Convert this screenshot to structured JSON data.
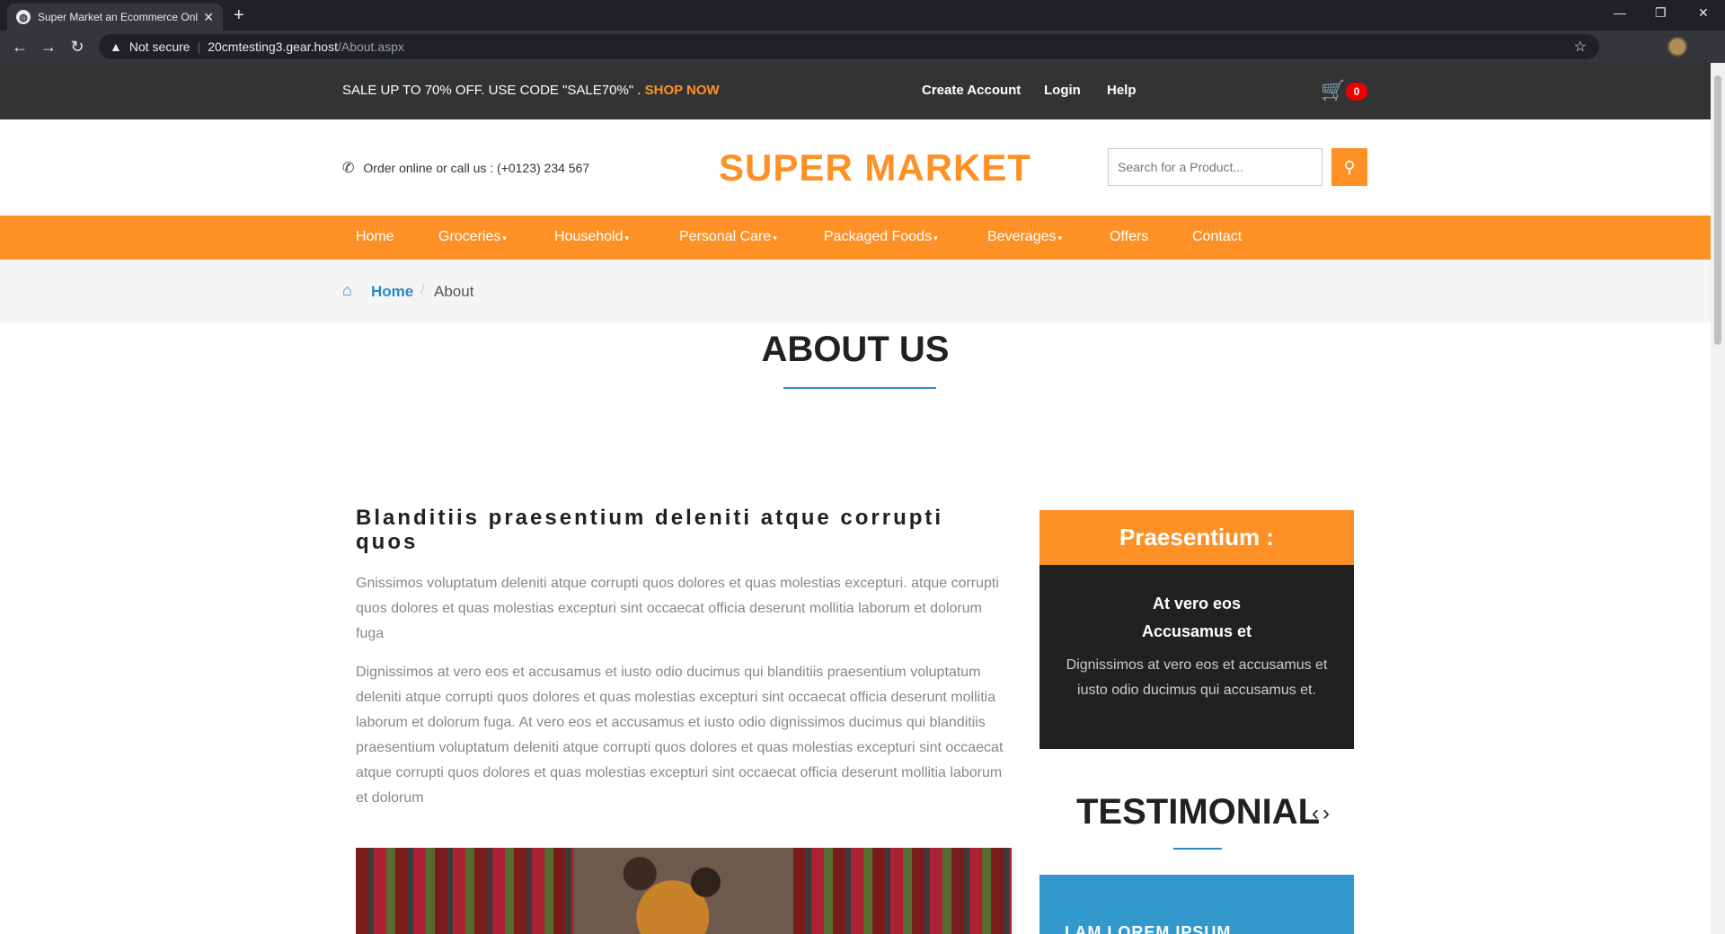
{
  "browser": {
    "tab_title": "Super Market an Ecommerce Onl",
    "security_label": "Not secure",
    "url_host": "20cmtesting3.gear.host",
    "url_path": "/About.aspx"
  },
  "topbar": {
    "promo_text": "SALE UP TO 70% OFF. USE CODE \"SALE70%\" . ",
    "promo_link": "SHOP NOW",
    "create_account": "Create Account",
    "login": "Login",
    "help": "Help",
    "cart_count": "0"
  },
  "header": {
    "phone_text": "Order online or call us : (+0123) 234 567",
    "brand": "SUPER MARKET",
    "search_placeholder": "Search for a Product..."
  },
  "nav": {
    "items": [
      "Home",
      "Groceries",
      "Household",
      "Personal Care",
      "Packaged Foods",
      "Beverages",
      "Offers",
      "Contact"
    ]
  },
  "breadcrumb": {
    "home": "Home",
    "separator": "/",
    "current": "About"
  },
  "about": {
    "title": "ABOUT US",
    "article_title": "Blanditiis praesentium deleniti atque corrupti quos",
    "para1": "Gnissimos voluptatum deleniti atque corrupti quos dolores et quas molestias excepturi. atque corrupti quos dolores et quas molestias excepturi sint occaecat officia deserunt mollitia laborum et dolorum fuga",
    "para2": "Dignissimos at vero eos et accusamus et iusto odio ducimus qui blanditiis praesentium voluptatum deleniti atque corrupti quos dolores et quas molestias excepturi sint occaecat officia deserunt mollitia laborum et dolorum fuga. At vero eos et accusamus et iusto odio dignissimos ducimus qui blanditiis praesentium voluptatum deleniti atque corrupti quos dolores et quas molestias excepturi sint occaecat atque corrupti quos dolores et quas molestias excepturi sint occaecat officia deserunt mollitia laborum et dolorum"
  },
  "sidebar": {
    "heading": "Praesentium :",
    "sub1": "At vero eos",
    "sub2": "Accusamus et",
    "text": "Dignissimos at vero eos et accusamus et iusto odio ducimus qui accusamus et."
  },
  "testimonial": {
    "title": "TESTIMONIAL",
    "name": "I AM LOREM IPSUM"
  },
  "colors": {
    "accent": "#fe9126",
    "link_blue": "#2a8ac9",
    "dark": "#212121",
    "topbar": "#333333"
  }
}
